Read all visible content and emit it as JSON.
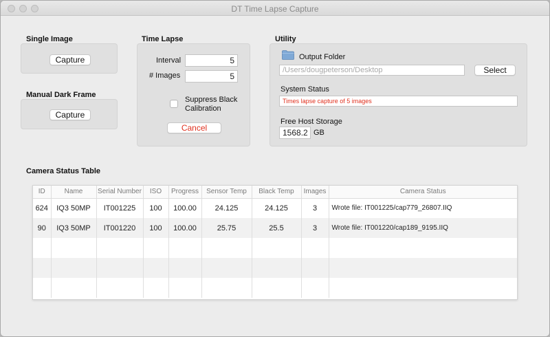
{
  "window": {
    "title": "DT Time Lapse Capture"
  },
  "single_image": {
    "heading": "Single Image",
    "capture_label": "Capture"
  },
  "dark_frame": {
    "heading": "Manual Dark Frame",
    "capture_label": "Capture"
  },
  "time_lapse": {
    "heading": "Time Lapse",
    "interval_label": "Interval",
    "interval_value": "5",
    "images_label": "#  Images",
    "images_value": "5",
    "suppress_label_line1": "Suppress Black",
    "suppress_label_line2": "Calibration",
    "suppress_checked": false,
    "cancel_label": "Cancel",
    "cancel_color": "#e0301e"
  },
  "utility": {
    "heading": "Utility",
    "output_folder_label": "Output Folder",
    "output_folder_placeholder": "/Users/dougpeterson/Desktop",
    "select_label": "Select",
    "system_status_label": "System Status",
    "system_status_value": "Times lapse capture of 5 images",
    "system_status_color": "#e0301e",
    "free_storage_label": "Free Host Storage",
    "free_storage_value": "1568.2",
    "free_storage_unit": "GB"
  },
  "camera_table": {
    "heading": "Camera Status Table",
    "columns": [
      "ID",
      "Name",
      "Serial Number",
      "ISO",
      "Progress",
      "Sensor Temp",
      "Black Temp",
      "Images",
      "Camera Status"
    ],
    "rows": [
      [
        "624",
        "IQ3 50MP",
        "IT001225",
        "100",
        "100.00",
        "24.125",
        "24.125",
        "3",
        "Wrote file: IT001225/cap779_26807.IIQ"
      ],
      [
        "90",
        "IQ3 50MP",
        "IT001220",
        "100",
        "100.00",
        "25.75",
        "25.5",
        "3",
        "Wrote file: IT001220/cap189_9195.IIQ"
      ]
    ],
    "empty_rows": 3
  }
}
